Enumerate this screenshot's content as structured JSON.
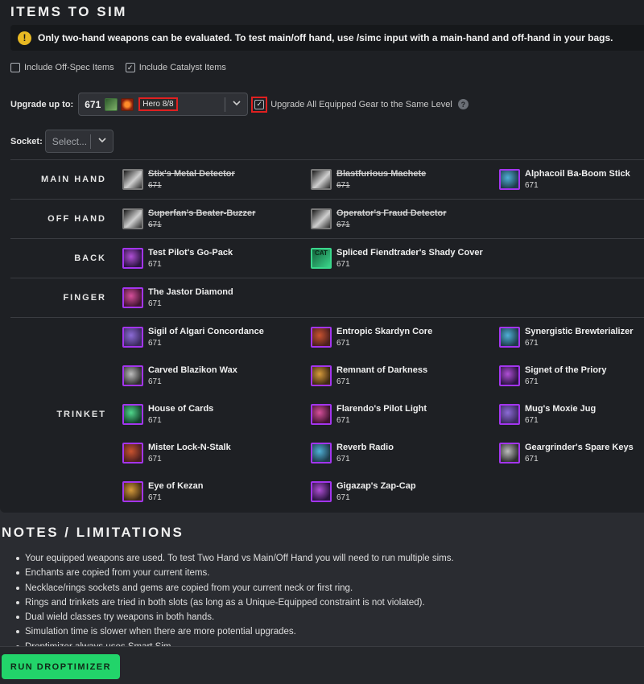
{
  "sections": {
    "items_title": "ITEMS TO SIM",
    "notes_title": "NOTES / LIMITATIONS"
  },
  "warning": {
    "icon": "warning-icon",
    "text": "Only two-hand weapons can be evaluated. To test main/off hand, use /simc input with a main-hand and off-hand in your bags."
  },
  "options": {
    "include_offspec": "Include Off-Spec Items",
    "include_offspec_checked": false,
    "include_catalyst": "Include Catalyst Items",
    "include_catalyst_checked": true
  },
  "upgrade": {
    "label": "Upgrade up to:",
    "item_level": "671",
    "track": "Hero 8/8",
    "all_equipped_label": "Upgrade All Equipped Gear to the Same Level",
    "all_equipped_checked": true
  },
  "socket": {
    "label": "Socket:",
    "placeholder": "Select..."
  },
  "slots": [
    {
      "name": "MAIN HAND",
      "items": [
        {
          "name": "Stix's Metal Detector",
          "ilvl": "671",
          "disabled": true,
          "icon": "grey"
        },
        {
          "name": "Blastfurious Machete",
          "ilvl": "671",
          "disabled": true,
          "icon": "grey"
        },
        {
          "name": "Alphacoil Ba-Boom Stick",
          "ilvl": "671",
          "disabled": false,
          "icon": "purple"
        }
      ]
    },
    {
      "name": "OFF HAND",
      "items": [
        {
          "name": "Superfan's Beater-Buzzer",
          "ilvl": "671",
          "disabled": true,
          "icon": "grey"
        },
        {
          "name": "Operator's Fraud Detector",
          "ilvl": "671",
          "disabled": true,
          "icon": "grey"
        }
      ]
    },
    {
      "name": "BACK",
      "items": [
        {
          "name": "Test Pilot's Go-Pack",
          "ilvl": "671",
          "disabled": false,
          "icon": "purple"
        },
        {
          "name": "Spliced Fiendtrader's Shady Cover",
          "ilvl": "671",
          "disabled": false,
          "icon": "catalyst",
          "badge": "CAT"
        }
      ]
    },
    {
      "name": "FINGER",
      "items": [
        {
          "name": "The Jastor Diamond",
          "ilvl": "671",
          "disabled": false,
          "icon": "purple"
        }
      ]
    },
    {
      "name": "TRINKET",
      "items": [
        {
          "name": "Sigil of Algari Concordance",
          "ilvl": "671",
          "disabled": false,
          "icon": "purple"
        },
        {
          "name": "Entropic Skardyn Core",
          "ilvl": "671",
          "disabled": false,
          "icon": "purple"
        },
        {
          "name": "Synergistic Brewterializer",
          "ilvl": "671",
          "disabled": false,
          "icon": "purple"
        },
        {
          "name": "Carved Blazikon Wax",
          "ilvl": "671",
          "disabled": false,
          "icon": "purple"
        },
        {
          "name": "Remnant of Darkness",
          "ilvl": "671",
          "disabled": false,
          "icon": "purple"
        },
        {
          "name": "Signet of the Priory",
          "ilvl": "671",
          "disabled": false,
          "icon": "purple"
        },
        {
          "name": "House of Cards",
          "ilvl": "671",
          "disabled": false,
          "icon": "purple"
        },
        {
          "name": "Flarendo's Pilot Light",
          "ilvl": "671",
          "disabled": false,
          "icon": "purple"
        },
        {
          "name": "Mug's Moxie Jug",
          "ilvl": "671",
          "disabled": false,
          "icon": "purple"
        },
        {
          "name": "Mister Lock-N-Stalk",
          "ilvl": "671",
          "disabled": false,
          "icon": "purple"
        },
        {
          "name": "Reverb Radio",
          "ilvl": "671",
          "disabled": false,
          "icon": "purple"
        },
        {
          "name": "Geargrinder's Spare Keys",
          "ilvl": "671",
          "disabled": false,
          "icon": "purple"
        },
        {
          "name": "Eye of Kezan",
          "ilvl": "671",
          "disabled": false,
          "icon": "purple"
        },
        {
          "name": "Gigazap's Zap-Cap",
          "ilvl": "671",
          "disabled": false,
          "icon": "purple"
        }
      ]
    }
  ],
  "notes": [
    "Your equipped weapons are used. To test Two Hand vs Main/Off Hand you will need to run multiple sims.",
    "Enchants are copied from your current items.",
    "Necklace/rings sockets and gems are copied from your current neck or first ring.",
    "Rings and trinkets are tried in both slots (as long as a Unique-Equipped constraint is not violated).",
    "Dual wield classes try weapons in both hands.",
    "Simulation time is slower when there are more potential upgrades.",
    "Droptimizer always uses Smart Sim."
  ],
  "footer": {
    "run_button": "RUN DROPTIMIZER"
  },
  "colors": {
    "accent_green": "#22d46a",
    "epic_purple": "#a335ee",
    "highlight_red": "#e02020",
    "warning_yellow": "#e8b923"
  }
}
